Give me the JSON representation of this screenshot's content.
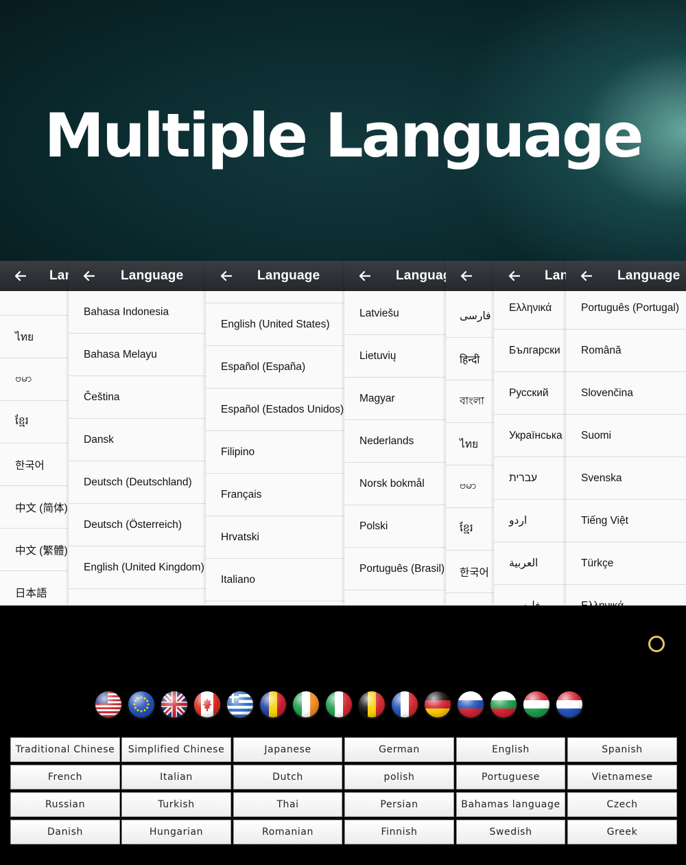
{
  "hero": {
    "title": "Multiple Language"
  },
  "panels": [
    {
      "title": "Language",
      "rows": [
        "",
        "ไทย",
        "ဗမာ",
        "ខ្មែរ",
        "한국어",
        "中文 (简体)",
        "中文 (繁體)",
        "日本語"
      ]
    },
    {
      "title": "Language",
      "rows": [
        "Bahasa Indonesia",
        "Bahasa Melayu",
        "Čeština",
        "Dansk",
        "Deutsch (Deutschland)",
        "Deutsch (Österreich)",
        "English (United Kingdom)",
        ""
      ]
    },
    {
      "title": "Language",
      "rows": [
        "",
        "English (United States)",
        "Español (España)",
        "Español (Estados Unidos)",
        "Filipino",
        "Français",
        "Hrvatski",
        "Italiano"
      ]
    },
    {
      "title": "Language",
      "rows": [
        "Latviešu",
        "Lietuvių",
        "Magyar",
        "Nederlands",
        "Norsk bokmål",
        "Polski",
        "Português (Brasil)"
      ]
    },
    {
      "title": "",
      "rows": [
        "فارسی",
        "हिन्दी",
        "বাংলা",
        "ไทย",
        "ဗမာ",
        "ខ្មែរ",
        "한국어"
      ]
    },
    {
      "title": "Language",
      "rows": [
        "Ελληνικά",
        "Български",
        "Русский",
        "Українська",
        "עברית",
        "اردو",
        "العربية",
        "فارسی"
      ]
    },
    {
      "title": "Language",
      "rows": [
        "Português (Portugal)",
        "Română",
        "Slovenčina",
        "Suomi",
        "Svenska",
        "Tiếng Việt",
        "Türkçe",
        "Ελληνικά"
      ]
    }
  ],
  "flags": [
    "usa-flag",
    "eu-flag",
    "uk-flag",
    "canada-flag",
    "greece-flag",
    "romania-flag",
    "ireland-flag",
    "italy-flag",
    "belgium-flag",
    "france-flag",
    "germany-flag",
    "russia-flag",
    "bulgaria-flag",
    "hungary-flag",
    "netherlands-flag"
  ],
  "languages": [
    [
      "Traditional Chinese",
      "Simplified Chinese",
      "Japanese",
      "German",
      "English",
      "Spanish"
    ],
    [
      "French",
      "Italian",
      "Dutch",
      "polish",
      "Portuguese",
      "Vietnamese"
    ],
    [
      "Russian",
      "Turkish",
      "Thai",
      "Persian",
      "Bahamas language",
      "Czech"
    ],
    [
      "Danish",
      "Hungarian",
      "Romanian",
      "Finnish",
      "Swedish",
      "Greek"
    ]
  ],
  "colors": {
    "ring": "#e3c56a",
    "appbar": "#2d3034",
    "hero": "#0b2a2e"
  }
}
